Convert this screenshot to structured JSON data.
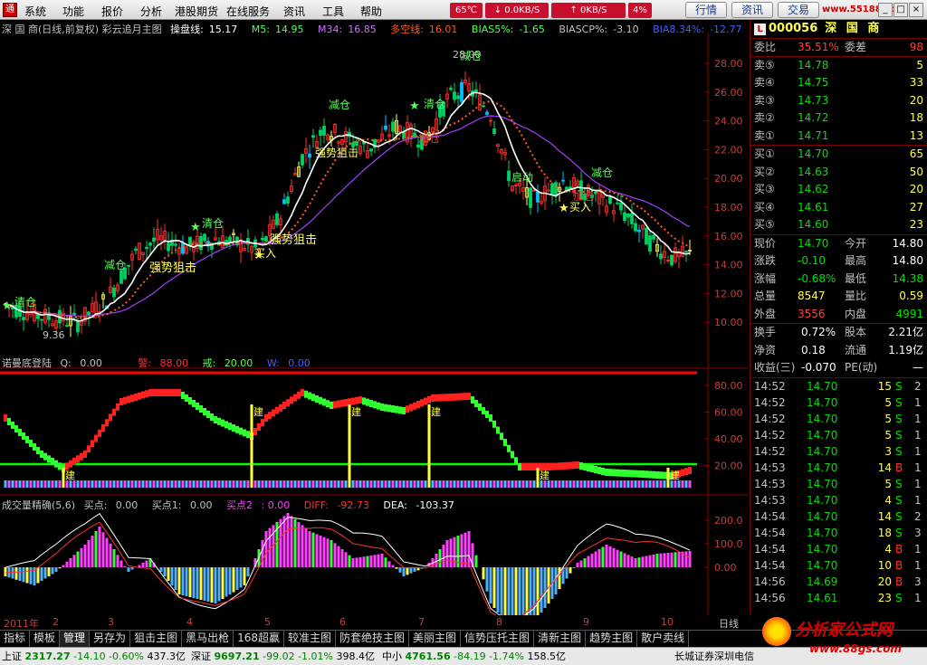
{
  "menubar": {
    "logo": "通",
    "items": [
      "系统",
      "功能",
      "报价",
      "分析",
      "港股期货",
      "在线服务",
      "资讯",
      "工具",
      "帮助"
    ],
    "temp": "65℃",
    "down_speed": "0.0KB/S",
    "up_speed": "0KB/S",
    "cpu": "4%",
    "buttons": [
      "行情",
      "资讯",
      "交易"
    ],
    "site": "www.55188.com"
  },
  "main_chart": {
    "header": {
      "name": "深 国 商(日线,前复权) 彩云追月主图",
      "cpl_label": "操盘线:",
      "cpl": "15.17",
      "m5_label": "M5:",
      "m5": "14.95",
      "m34_label": "M34:",
      "m34": "16.85",
      "dkx_label": "多空线:",
      "dkx": "16.01",
      "bias5_label": "BIAS5%:",
      "bias5": "-1.65",
      "biascp_label": "BIASCP%:",
      "biascp": "-3.10",
      "bias8_label": "BIA8.34%:",
      "bias8": "-12.77"
    },
    "price_ticks": [
      "28.00",
      "26.00",
      "24.00",
      "22.00",
      "20.00",
      "18.00",
      "16.00",
      "14.00",
      "12.00",
      "10.00"
    ],
    "annotations": {
      "qing1": "清仓",
      "jian1": "减仓",
      "qing2": "清仓",
      "qiang1": "强势狙击",
      "qiang2": "强势狙击",
      "buy1": "买入",
      "jian2": "减仓",
      "qiang3": "强势狙击",
      "jia1": "加仓",
      "qing3": "清仓",
      "jian3": "减仓",
      "qidong": "启动",
      "jia2": "加仓",
      "buy2": "买入",
      "jian4": "减仓",
      "low": "9.36",
      "high": "28.00"
    }
  },
  "ind1": {
    "header": {
      "name": "诺曼底登陆",
      "q_label": "Q:",
      "q": "0.00",
      "jing_label": "警:",
      "jing": "88.00",
      "jie_label": "戒:",
      "jie": "20.00",
      "w_label": "W:",
      "w": "0.00"
    },
    "ticks": [
      "80.00",
      "60.00",
      "40.00",
      "20.00"
    ],
    "mark": "建"
  },
  "ind2": {
    "header": {
      "name": "成交量精确(5,6)",
      "b_label": "买点:",
      "b": "0.00",
      "b1_label": "买点1:",
      "b1": "0.00",
      "b2_label": "买点2",
      "b2": "0.00",
      "diff_label": "DIFF:",
      "diff": "-92.73",
      "dea_label": "DEA:",
      "dea": "-103.37"
    },
    "ticks": [
      "200.0",
      "100.0",
      "0.00"
    ]
  },
  "timeaxis": {
    "labels": [
      "2011年",
      "2",
      "3",
      "4",
      "5",
      "6",
      "7",
      "8",
      "9",
      "10"
    ],
    "period": "日线"
  },
  "quote": {
    "code": "000056",
    "name": "深 国 商",
    "wb_label": "委比",
    "wb": "35.51%",
    "wc_label": "委差",
    "wc": "98",
    "asks": [
      {
        "label": "卖⑤",
        "price": "14.78",
        "vol": "5"
      },
      {
        "label": "卖④",
        "price": "14.75",
        "vol": "33"
      },
      {
        "label": "卖③",
        "price": "14.73",
        "vol": "20"
      },
      {
        "label": "卖②",
        "price": "14.72",
        "vol": "18"
      },
      {
        "label": "卖①",
        "price": "14.71",
        "vol": "13"
      }
    ],
    "bids": [
      {
        "label": "买①",
        "price": "14.70",
        "vol": "65"
      },
      {
        "label": "买②",
        "price": "14.63",
        "vol": "50"
      },
      {
        "label": "买③",
        "price": "14.62",
        "vol": "20"
      },
      {
        "label": "买④",
        "price": "14.61",
        "vol": "27"
      },
      {
        "label": "买⑤",
        "price": "14.60",
        "vol": "23"
      }
    ],
    "stats": [
      {
        "l1": "现价",
        "v1": "14.70",
        "l2": "今开",
        "v2": "14.80",
        "c1": "#00e000",
        "c2": "#ffffff"
      },
      {
        "l1": "涨跌",
        "v1": "-0.10",
        "l2": "最高",
        "v2": "14.80",
        "c1": "#00e000",
        "c2": "#ffffff"
      },
      {
        "l1": "涨幅",
        "v1": "-0.68%",
        "l2": "最低",
        "v2": "14.38",
        "c1": "#00e000",
        "c2": "#00e000"
      },
      {
        "l1": "总量",
        "v1": "8547",
        "l2": "量比",
        "v2": "0.59",
        "c1": "#ffff55",
        "c2": "#ffff55"
      },
      {
        "l1": "外盘",
        "v1": "3556",
        "l2": "内盘",
        "v2": "4991",
        "c1": "#ff4040",
        "c2": "#00e000"
      }
    ],
    "fin": [
      {
        "l1": "换手",
        "v1": "0.72%",
        "l2": "股本",
        "v2": "2.21亿"
      },
      {
        "l1": "净资",
        "v1": "0.18",
        "l2": "流通",
        "v2": "1.19亿"
      },
      {
        "l1": "收益(三)",
        "v1": "-0.070",
        "l2": "PE(动)",
        "v2": "—"
      }
    ],
    "ticks": [
      {
        "t": "14:52",
        "p": "14.70",
        "v": "15",
        "s": "S",
        "n": "2"
      },
      {
        "t": "14:52",
        "p": "14.70",
        "v": "5",
        "s": "S",
        "n": "1"
      },
      {
        "t": "14:52",
        "p": "14.70",
        "v": "5",
        "s": "S",
        "n": "1"
      },
      {
        "t": "14:52",
        "p": "14.70",
        "v": "5",
        "s": "S",
        "n": "1"
      },
      {
        "t": "14:52",
        "p": "14.70",
        "v": "3",
        "s": "S",
        "n": "1"
      },
      {
        "t": "14:53",
        "p": "14.70",
        "v": "14",
        "s": "B",
        "n": "1"
      },
      {
        "t": "14:53",
        "p": "14.70",
        "v": "5",
        "s": "S",
        "n": "1"
      },
      {
        "t": "14:53",
        "p": "14.70",
        "v": "4",
        "s": "S",
        "n": "1"
      },
      {
        "t": "14:54",
        "p": "14.70",
        "v": "14",
        "s": "S",
        "n": "2"
      },
      {
        "t": "14:54",
        "p": "14.70",
        "v": "18",
        "s": "S",
        "n": "3"
      },
      {
        "t": "14:54",
        "p": "14.70",
        "v": "4",
        "s": "B",
        "n": "1"
      },
      {
        "t": "14:54",
        "p": "14.70",
        "v": "10",
        "s": "B",
        "n": "1"
      },
      {
        "t": "14:56",
        "p": "14.69",
        "v": "20",
        "s": "B",
        "n": "3"
      },
      {
        "t": "14:56",
        "p": "14.61",
        "v": "23",
        "s": "S",
        "n": "1"
      }
    ]
  },
  "tabs": [
    "指标",
    "模板",
    "管理",
    "另存为",
    "狙击主图",
    "黑马出枪",
    "168超赢",
    "较准主图",
    "防套绝技主图",
    "美丽主图",
    "信势压托主图",
    "清新主图",
    "趋势主图",
    "散户卖线"
  ],
  "active_tab": "管理",
  "status": {
    "sh_label": "上证",
    "sh": "2317.27",
    "sh_chg": "-14.10",
    "sh_pct": "-0.60%",
    "sh_amt": "437.3亿",
    "sz_label": "深证",
    "sz": "9697.21",
    "sz_chg": "-99.02",
    "sz_pct": "-1.01%",
    "sz_amt": "398.4亿",
    "zx_label": "中小",
    "zx": "4761.56",
    "zx_chg": "-84.19",
    "zx_pct": "-1.74%",
    "zx_amt": "158.5亿",
    "broker": "长城证券深圳电信"
  },
  "watermark": {
    "w1": "分析家公式网",
    "w2": "www.88gs.com"
  }
}
